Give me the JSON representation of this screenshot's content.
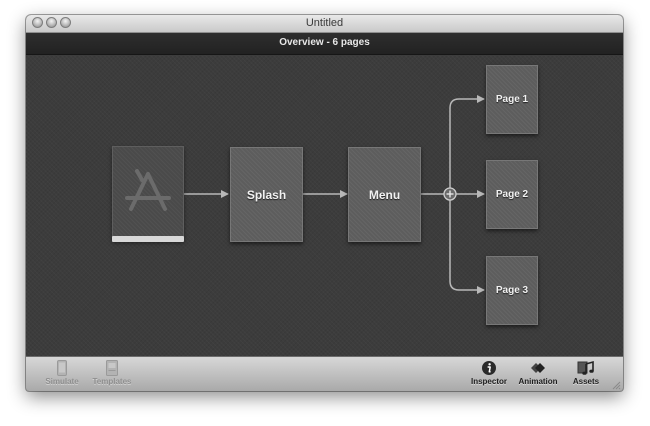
{
  "window": {
    "title": "Untitled"
  },
  "header": {
    "title": "Overview - 6 pages"
  },
  "flow": {
    "app_icon": "app-store-icon",
    "app_progress": 1.0,
    "pages": [
      {
        "id": "splash",
        "label": "Splash"
      },
      {
        "id": "menu",
        "label": "Menu"
      },
      {
        "id": "page1",
        "label": "Page 1"
      },
      {
        "id": "page2",
        "label": "Page 2"
      },
      {
        "id": "page3",
        "label": "Page 3"
      }
    ],
    "branch_icon": "plus-icon"
  },
  "toolbar": {
    "left": [
      {
        "label": "Simulate",
        "icon": "device-icon",
        "enabled": false
      },
      {
        "label": "Templates",
        "icon": "template-icon",
        "enabled": false
      }
    ],
    "right": [
      {
        "label": "Inspector",
        "icon": "info-icon",
        "enabled": true
      },
      {
        "label": "Animation",
        "icon": "animation-icon",
        "enabled": true
      },
      {
        "label": "Assets",
        "icon": "music-note-icon",
        "enabled": true
      }
    ]
  },
  "colors": {
    "canvas": "#3c3c3c",
    "card": "#5d5d5d",
    "connector": "#b8b8b8"
  }
}
